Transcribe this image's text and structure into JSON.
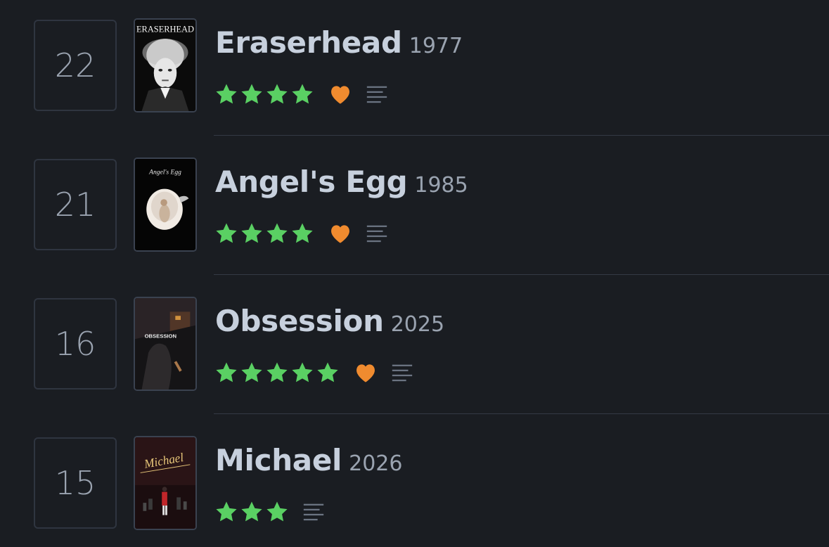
{
  "colors": {
    "background": "#1a1d22",
    "star": "#5ad063",
    "heart": "#f08b2f",
    "title": "#c7d0dd",
    "muted": "#9aa3b0",
    "divider": "#343a45"
  },
  "entries": [
    {
      "rank": "22",
      "title": "Eraserhead",
      "year": "1977",
      "rating_stars": 4,
      "liked": true,
      "has_review": true,
      "poster_text": "ERASERHEAD"
    },
    {
      "rank": "21",
      "title": "Angel's Egg",
      "year": "1985",
      "rating_stars": 4,
      "liked": true,
      "has_review": true,
      "poster_text": "Angel's Egg"
    },
    {
      "rank": "16",
      "title": "Obsession",
      "year": "2025",
      "rating_stars": 5,
      "liked": true,
      "has_review": true,
      "poster_text": "OBSESSION"
    },
    {
      "rank": "15",
      "title": "Michael",
      "year": "2026",
      "rating_stars": 3,
      "liked": false,
      "has_review": true,
      "poster_text": "Michael"
    }
  ],
  "icons": {
    "star": "star-icon",
    "heart": "heart-icon",
    "review": "review-text-icon"
  }
}
